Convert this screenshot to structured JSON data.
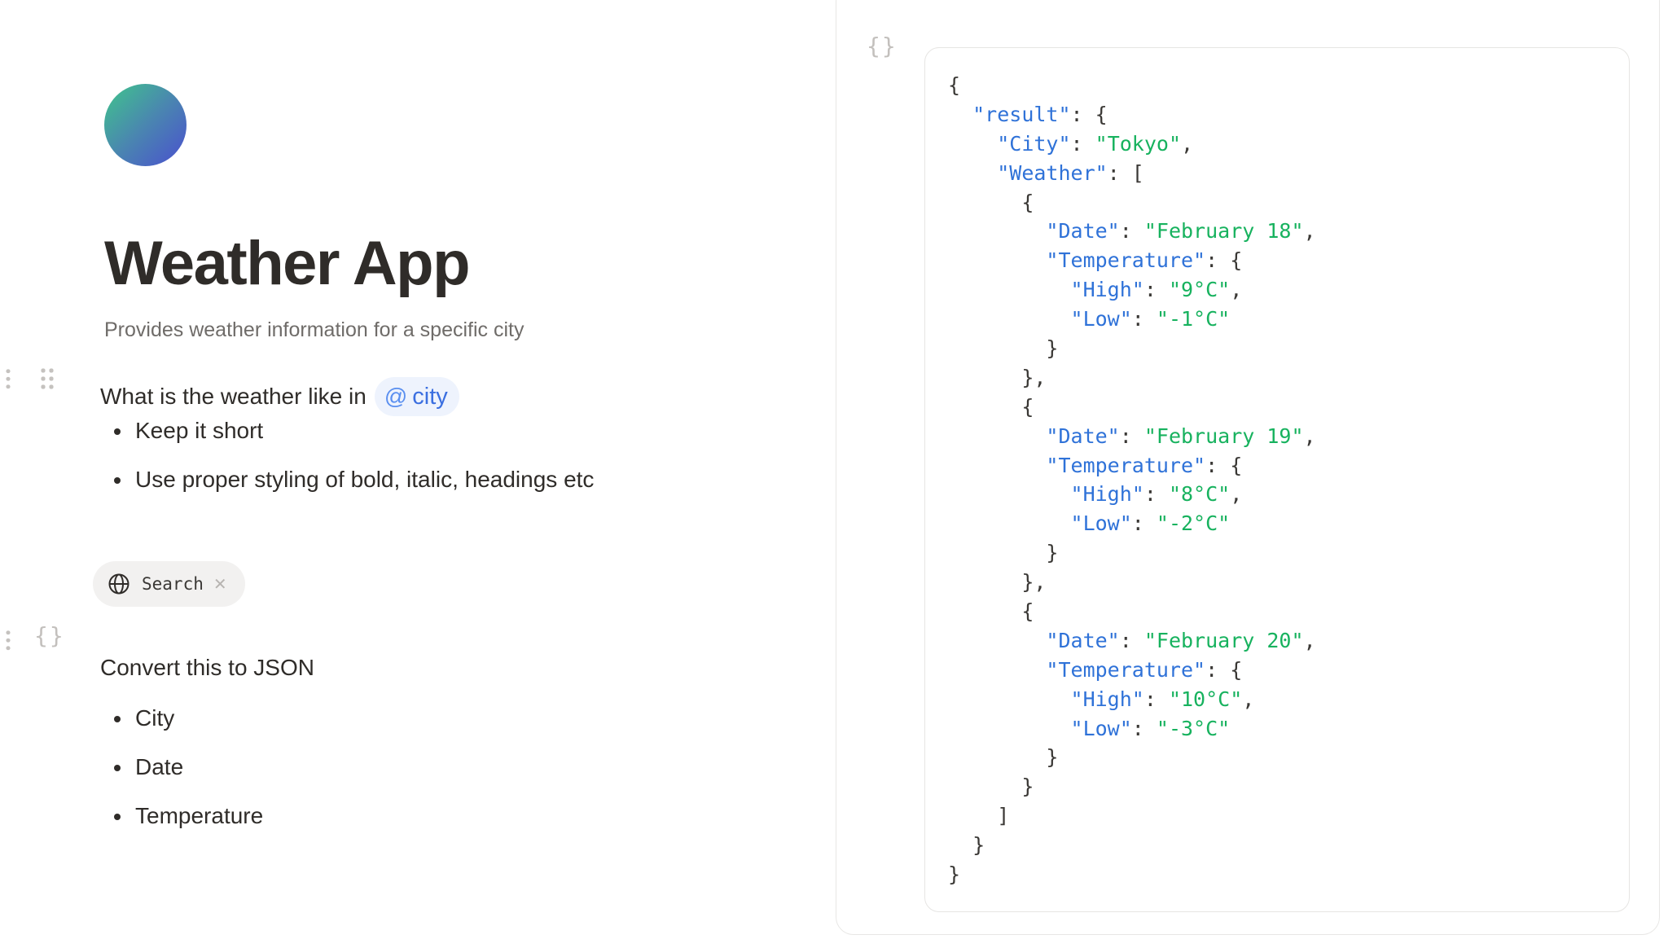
{
  "app": {
    "title": "Weather App",
    "description": "Provides weather information for a specific city"
  },
  "prompt": {
    "text": "What is the weather like in",
    "variable": "city",
    "variable_prefix": "@",
    "instructions": [
      "Keep it short",
      "Use proper styling of bold, italic, headings etc"
    ]
  },
  "tool": {
    "label": "Search",
    "icon": "globe-icon",
    "remove_icon": "close-icon"
  },
  "json_block": {
    "icon_text": "{}",
    "text": "Convert this to JSON",
    "fields": [
      "City",
      "Date",
      "Temperature"
    ]
  },
  "output": {
    "icon_text": "{}",
    "result": {
      "City": "Tokyo",
      "Weather": [
        {
          "Date": "February 18",
          "Temperature": {
            "High": "9°C",
            "Low": "-1°C"
          }
        },
        {
          "Date": "February 19",
          "Temperature": {
            "High": "8°C",
            "Low": "-2°C"
          }
        },
        {
          "Date": "February 20",
          "Temperature": {
            "High": "10°C",
            "Low": "-3°C"
          }
        }
      ]
    }
  },
  "colors": {
    "key": "#2f72d8",
    "string": "#17b25e",
    "mention_bg": "#eef3fd",
    "mention_text": "#3b6fe0",
    "avatar_start": "#3fc68b",
    "avatar_end": "#4a4fcf"
  }
}
